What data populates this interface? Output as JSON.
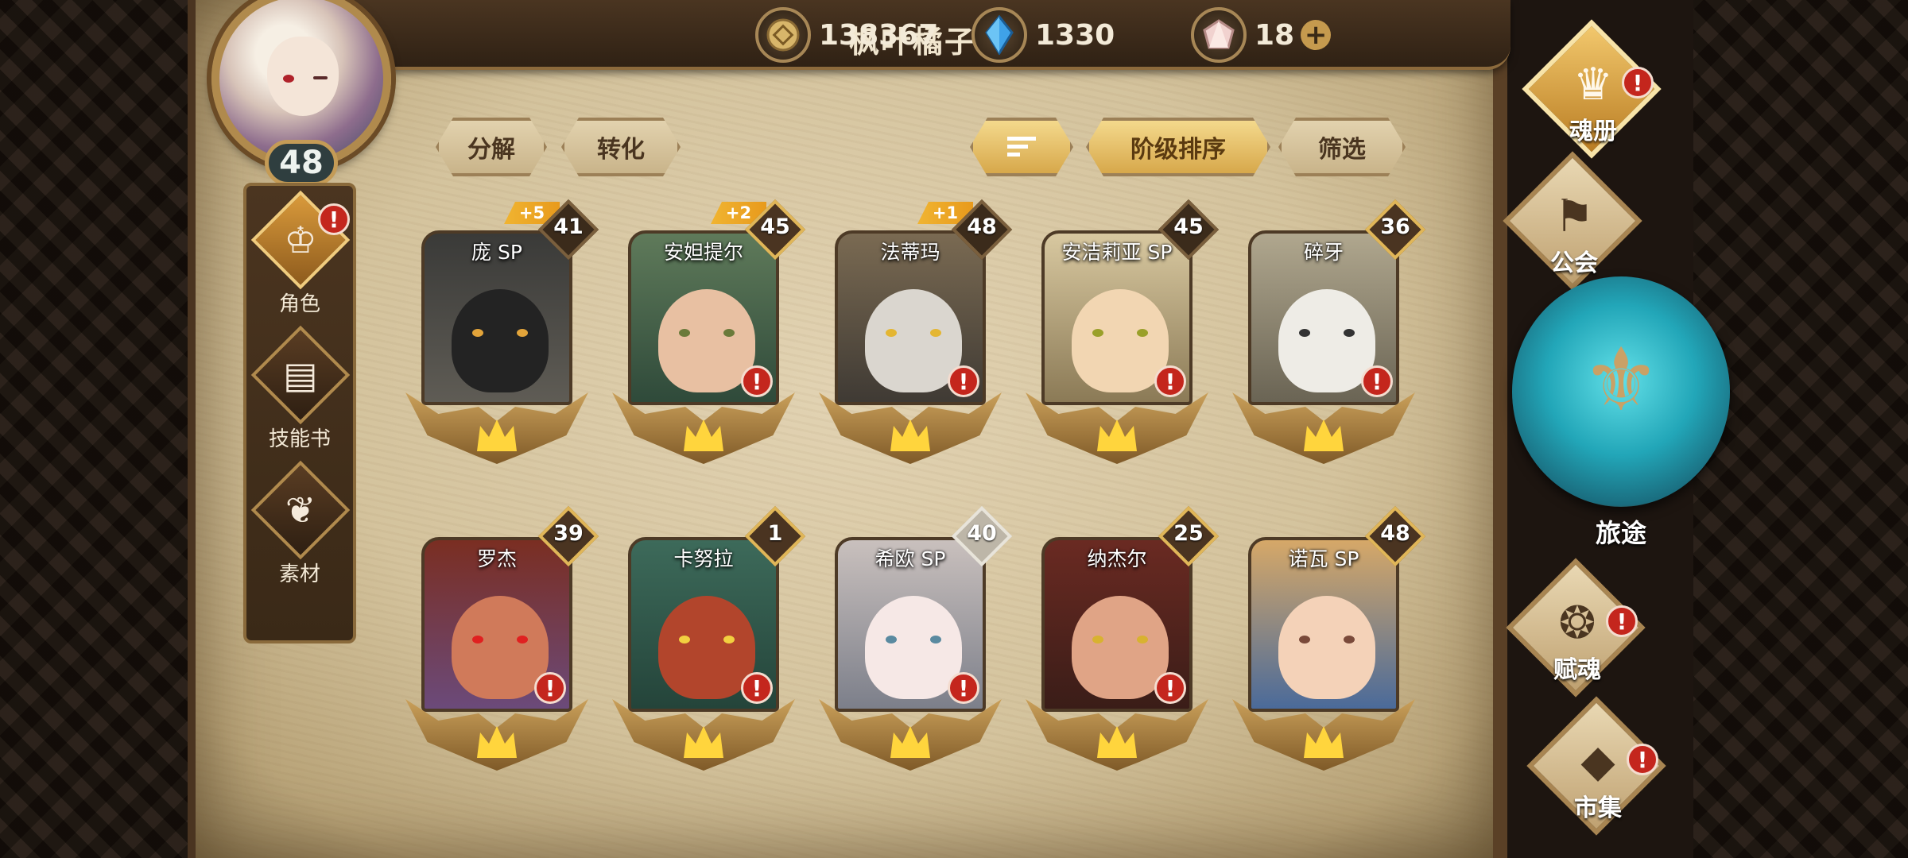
{
  "player": {
    "name": "枫叶橘子",
    "level": "48"
  },
  "currencies": [
    {
      "icon": "gold-coin-icon",
      "value": "138367"
    },
    {
      "icon": "blue-crystal-icon",
      "value": "1330"
    },
    {
      "icon": "pink-gem-icon",
      "value": "18",
      "plus": "+"
    }
  ],
  "left_tabs": [
    {
      "label": "角色",
      "icon": "character-icon",
      "alert": "!"
    },
    {
      "label": "技能书",
      "icon": "skill-book-icon"
    },
    {
      "label": "素材",
      "icon": "material-icon"
    }
  ],
  "toolbar": {
    "decompose": "分解",
    "convert": "转化",
    "sort_order_icon": "sort-lines-icon",
    "rank_sort": "阶级排序",
    "filter": "筛选"
  },
  "heroes": [
    {
      "name": "庞 SP",
      "level": "41",
      "bonus": "+5",
      "frame": "dark"
    },
    {
      "name": "安妲提尔",
      "level": "45",
      "bonus": "+2",
      "frame": "gold",
      "alert": "!"
    },
    {
      "name": "法蒂玛",
      "level": "48",
      "bonus": "+1",
      "frame": "dark",
      "alert": "!"
    },
    {
      "name": "安洁莉亚 SP",
      "level": "45",
      "frame": "dark",
      "alert": "!"
    },
    {
      "name": "碎牙",
      "level": "36",
      "frame": "gold",
      "alert": "!"
    },
    {
      "name": "罗杰",
      "level": "39",
      "frame": "gold",
      "alert": "!"
    },
    {
      "name": "卡努拉",
      "level": "1",
      "frame": "gold",
      "alert": "!"
    },
    {
      "name": "希欧 SP",
      "level": "40",
      "frame": "silver",
      "alert": "!"
    },
    {
      "name": "纳杰尔",
      "level": "25",
      "frame": "gold",
      "alert": "!"
    },
    {
      "name": "诺瓦 SP",
      "level": "48",
      "frame": "gold"
    }
  ],
  "right_nav": [
    {
      "label": "魂册",
      "icon": "soul-book-icon",
      "alert": "!"
    },
    {
      "label": "公会",
      "icon": "guild-icon"
    },
    {
      "label": "旅途",
      "icon": "journey-emblem-icon"
    },
    {
      "label": "赋魂",
      "icon": "flame-icon",
      "alert": "!"
    },
    {
      "label": "市集",
      "icon": "market-gem-icon",
      "alert": "!"
    }
  ],
  "colors": {
    "parchment": "#d4c39d",
    "accent_gold": "#e0b658",
    "alert_red": "#c4261d",
    "journey_teal": "#22a6b8"
  }
}
